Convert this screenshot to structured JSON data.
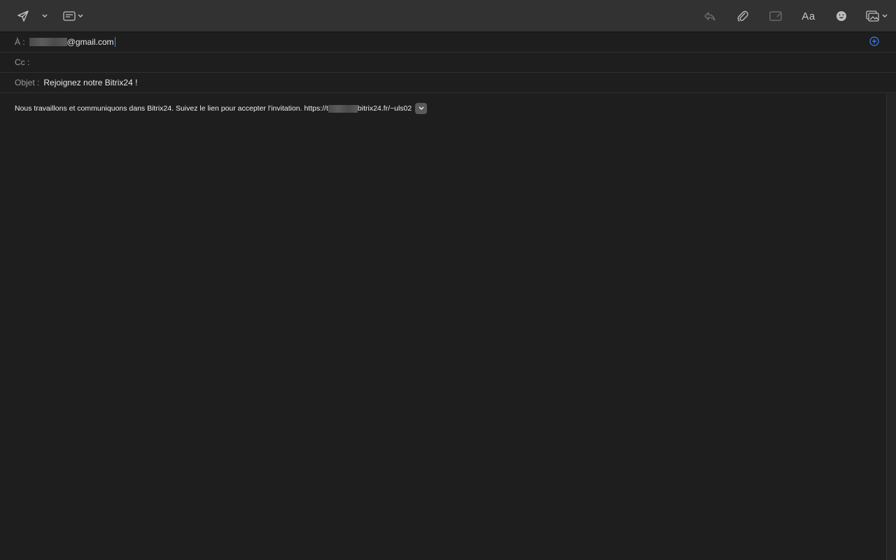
{
  "toolbar": {
    "send_icon": "paper-plane-icon",
    "send_options_icon": "chevron-down-icon",
    "header_fields_icon": "header-fields-icon",
    "reply_icon": "reply-icon",
    "attach_icon": "paperclip-icon",
    "markup_icon": "markup-icon",
    "format_label": "Aa",
    "emoji_icon": "emoji-icon",
    "photo_icon": "photo-browser-icon"
  },
  "fields": {
    "to_label": "À :",
    "to_value_suffix": "@gmail.com",
    "cc_label": "Cc :",
    "cc_value": "",
    "subject_label": "Objet :",
    "subject_value": "Rejoignez notre Bitrix24 !"
  },
  "body": {
    "text_before_redaction": "Nous travaillons et communiquons dans Bitrix24. Suivez le lien pour accepter l'invitation. https://t",
    "text_after_redaction": "bitrix24.fr/~uls02"
  },
  "colors": {
    "accent": "#3a82f7",
    "background": "#1e1e1e",
    "toolbar": "#323232"
  }
}
